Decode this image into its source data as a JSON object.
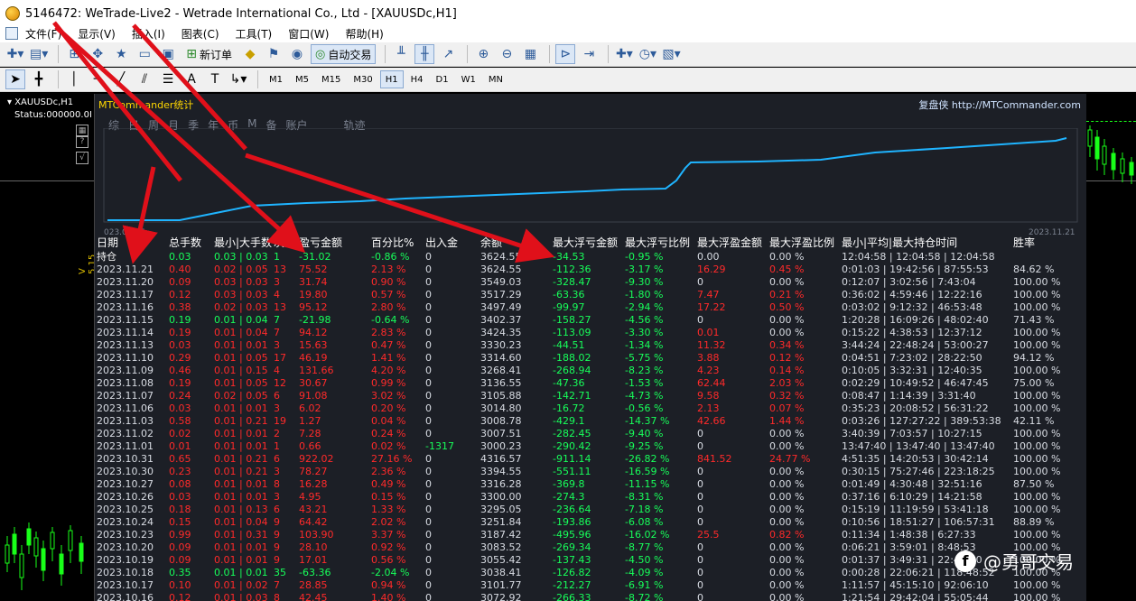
{
  "window": {
    "title": "5146472: WeTrade-Live2 - Wetrade International Co., Ltd - [XAUUSDc,H1]"
  },
  "menu": [
    "文件(F)",
    "显示(V)",
    "插入(I)",
    "图表(C)",
    "工具(T)",
    "窗口(W)",
    "帮助(H)"
  ],
  "toolbar1": {
    "new_order": "新订单",
    "auto_trade": "自动交易"
  },
  "timeframes": [
    "M1",
    "M5",
    "M15",
    "M30",
    "H1",
    "H4",
    "D1",
    "W1",
    "MN"
  ],
  "active_timeframe": "H1",
  "left_chart": {
    "symbol": "XAUUSDc,H1",
    "status": "Status:000000.0I",
    "side_label": "V 5.15"
  },
  "panel": {
    "title": "MTCommander统计",
    "brand": "复盘侠 http://MTCommander.com",
    "tabs": [
      "综",
      "日",
      "周",
      "月",
      "季",
      "年",
      "币",
      "M",
      "备",
      "账户"
    ],
    "track_label": "轨迹",
    "curve_start_label": "023.09.25",
    "curve_end_label": "2023.11.21"
  },
  "table": {
    "headers": [
      "日期",
      "总手数",
      "最小|大手数",
      "次数",
      "盈亏金额",
      "百分比%",
      "出入金",
      "余额",
      "最大浮亏金额",
      "最大浮亏比例",
      "最大浮盈金额",
      "最大浮盈比例",
      "最小|平均|最大持仓时间",
      "胜率"
    ],
    "holding_label": "持仓",
    "holding": [
      "0.03",
      "0.03 | 0.03",
      "1",
      "-31.02",
      "-0.86 %",
      "0",
      "3624.55",
      "-34.53",
      "-0.95 %",
      "0.00",
      "0.00 %",
      "12:04:58 | 12:04:58 | 12:04:58",
      ""
    ],
    "rows": [
      [
        "2023.11.21",
        "0.40",
        "0.02 | 0.05",
        "13",
        "75.52",
        "2.13 %",
        "0",
        "3624.55",
        "-112.36",
        "-3.17 %",
        "16.29",
        "0.45 %",
        "0:01:03 | 19:42:56 | 87:55:53",
        "84.62 %"
      ],
      [
        "2023.11.20",
        "0.09",
        "0.03 | 0.03",
        "3",
        "31.74",
        "0.90 %",
        "0",
        "3549.03",
        "-328.47",
        "-9.30 %",
        "0",
        "0.00 %",
        "0:12:07 | 3:02:56 | 7:43:04",
        "100.00 %"
      ],
      [
        "2023.11.17",
        "0.12",
        "0.03 | 0.03",
        "4",
        "19.80",
        "0.57 %",
        "0",
        "3517.29",
        "-63.36",
        "-1.80 %",
        "7.47",
        "0.21 %",
        "0:36:02 | 4:59:46 | 12:22:16",
        "100.00 %"
      ],
      [
        "2023.11.16",
        "0.38",
        "0.02 | 0.03",
        "13",
        "95.12",
        "2.80 %",
        "0",
        "3497.49",
        "-99.97",
        "-2.94 %",
        "17.22",
        "0.50 %",
        "0:03:02 | 9:12:32 | 46:53:48",
        "100.00 %"
      ],
      [
        "2023.11.15",
        "0.19",
        "0.01 | 0.04",
        "7",
        "-21.98",
        "-0.64 %",
        "0",
        "3402.37",
        "-158.27",
        "-4.56 %",
        "0",
        "0.00 %",
        "1:20:28 | 16:09:26 | 48:02:40",
        "71.43 %"
      ],
      [
        "2023.11.14",
        "0.19",
        "0.01 | 0.04",
        "7",
        "94.12",
        "2.83 %",
        "0",
        "3424.35",
        "-113.09",
        "-3.30 %",
        "0.01",
        "0.00 %",
        "0:15:22 | 4:38:53 | 12:37:12",
        "100.00 %"
      ],
      [
        "2023.11.13",
        "0.03",
        "0.01 | 0.01",
        "3",
        "15.63",
        "0.47 %",
        "0",
        "3330.23",
        "-44.51",
        "-1.34 %",
        "11.32",
        "0.34 %",
        "3:44:24 | 22:48:24 | 53:00:27",
        "100.00 %"
      ],
      [
        "2023.11.10",
        "0.29",
        "0.01 | 0.05",
        "17",
        "46.19",
        "1.41 %",
        "0",
        "3314.60",
        "-188.02",
        "-5.75 %",
        "3.88",
        "0.12 %",
        "0:04:51 | 7:23:02 | 28:22:50",
        "94.12 %"
      ],
      [
        "2023.11.09",
        "0.46",
        "0.01 | 0.15",
        "4",
        "131.66",
        "4.20 %",
        "0",
        "3268.41",
        "-268.94",
        "-8.23 %",
        "4.23",
        "0.14 %",
        "0:10:05 | 3:32:31 | 12:40:35",
        "100.00 %"
      ],
      [
        "2023.11.08",
        "0.19",
        "0.01 | 0.05",
        "12",
        "30.67",
        "0.99 %",
        "0",
        "3136.55",
        "-47.36",
        "-1.53 %",
        "62.44",
        "2.03 %",
        "0:02:29 | 10:49:52 | 46:47:45",
        "75.00 %"
      ],
      [
        "2023.11.07",
        "0.24",
        "0.02 | 0.05",
        "6",
        "91.08",
        "3.02 %",
        "0",
        "3105.88",
        "-142.71",
        "-4.73 %",
        "9.58",
        "0.32 %",
        "0:08:47 | 1:14:39 | 3:31:40",
        "100.00 %"
      ],
      [
        "2023.11.06",
        "0.03",
        "0.01 | 0.01",
        "3",
        "6.02",
        "0.20 %",
        "0",
        "3014.80",
        "-16.72",
        "-0.56 %",
        "2.13",
        "0.07 %",
        "0:35:23 | 20:08:52 | 56:31:22",
        "100.00 %"
      ],
      [
        "2023.11.03",
        "0.58",
        "0.01 | 0.21",
        "19",
        "1.27",
        "0.04 %",
        "0",
        "3008.78",
        "-429.1",
        "-14.37 %",
        "42.66",
        "1.44 %",
        "0:03:26 | 127:27:22 | 389:53:38",
        "42.11 %"
      ],
      [
        "2023.11.02",
        "0.02",
        "0.01 | 0.01",
        "2",
        "7.28",
        "0.24 %",
        "0",
        "3007.51",
        "-282.45",
        "-9.40 %",
        "0",
        "0.00 %",
        "3:40:39 | 7:03:57 | 10:27:15",
        "100.00 %"
      ],
      [
        "2023.11.01",
        "0.01",
        "0.01 | 0.01",
        "1",
        "0.66",
        "0.02 %",
        "-1317",
        "3000.23",
        "-290.42",
        "-9.25 %",
        "0",
        "0.00 %",
        "13:47:40 | 13:47:40 | 13:47:40",
        "100.00 %"
      ],
      [
        "2023.10.31",
        "0.65",
        "0.01 | 0.21",
        "6",
        "922.02",
        "27.16 %",
        "0",
        "4316.57",
        "-911.14",
        "-26.82 %",
        "841.52",
        "24.77 %",
        "4:51:35 | 14:20:53 | 30:42:14",
        "100.00 %"
      ],
      [
        "2023.10.30",
        "0.23",
        "0.01 | 0.21",
        "3",
        "78.27",
        "2.36 %",
        "0",
        "3394.55",
        "-551.11",
        "-16.59 %",
        "0",
        "0.00 %",
        "0:30:15 | 75:27:46 | 223:18:25",
        "100.00 %"
      ],
      [
        "2023.10.27",
        "0.08",
        "0.01 | 0.01",
        "8",
        "16.28",
        "0.49 %",
        "0",
        "3316.28",
        "-369.8",
        "-11.15 %",
        "0",
        "0.00 %",
        "0:01:49 | 4:30:48 | 32:51:16",
        "87.50 %"
      ],
      [
        "2023.10.26",
        "0.03",
        "0.01 | 0.01",
        "3",
        "4.95",
        "0.15 %",
        "0",
        "3300.00",
        "-274.3",
        "-8.31 %",
        "0",
        "0.00 %",
        "0:37:16 | 6:10:29 | 14:21:58",
        "100.00 %"
      ],
      [
        "2023.10.25",
        "0.18",
        "0.01 | 0.13",
        "6",
        "43.21",
        "1.33 %",
        "0",
        "3295.05",
        "-236.64",
        "-7.18 %",
        "0",
        "0.00 %",
        "0:15:19 | 11:19:59 | 53:41:18",
        "100.00 %"
      ],
      [
        "2023.10.24",
        "0.15",
        "0.01 | 0.04",
        "9",
        "64.42",
        "2.02 %",
        "0",
        "3251.84",
        "-193.86",
        "-6.08 %",
        "0",
        "0.00 %",
        "0:10:56 | 18:51:27 | 106:57:31",
        "88.89 %"
      ],
      [
        "2023.10.23",
        "0.99",
        "0.01 | 0.31",
        "9",
        "103.90",
        "3.37 %",
        "0",
        "3187.42",
        "-495.96",
        "-16.02 %",
        "25.5",
        "0.82 %",
        "0:11:34 | 1:48:38 | 6:27:33",
        "100.00 %"
      ],
      [
        "2023.10.20",
        "0.09",
        "0.01 | 0.01",
        "9",
        "28.10",
        "0.92 %",
        "0",
        "3083.52",
        "-269.34",
        "-8.77 %",
        "0",
        "0.00 %",
        "0:06:21 | 3:59:01 | 8:48:53",
        "100.00 %"
      ],
      [
        "2023.10.19",
        "0.09",
        "0.01 | 0.01",
        "9",
        "17.01",
        "0.56 %",
        "0",
        "3055.42",
        "-137.43",
        "-4.50 %",
        "0",
        "0.00 %",
        "0:01:37 | 3:49:31 | 22:43:50",
        "100.00 %"
      ],
      [
        "2023.10.18",
        "0.35",
        "0.01 | 0.01",
        "35",
        "-63.36",
        "-2.04 %",
        "0",
        "3038.41",
        "-126.82",
        "-4.09 %",
        "0",
        "0.00 %",
        "0:00:28 | 22:06:21 | 118:48:52",
        "100.00 %"
      ],
      [
        "2023.10.17",
        "0.10",
        "0.01 | 0.02",
        "7",
        "28.85",
        "0.94 %",
        "0",
        "3101.77",
        "-212.27",
        "-6.91 %",
        "0",
        "0.00 %",
        "1:11:57 | 45:15:10 | 92:06:10",
        "100.00 %"
      ],
      [
        "2023.10.16",
        "0.12",
        "0.01 | 0.03",
        "8",
        "42.45",
        "1.40 %",
        "0",
        "3072.92",
        "-266.33",
        "-8.72 %",
        "0",
        "0.00 %",
        "1:21:54 | 29:42:04 | 55:05:44",
        "100.00 %"
      ]
    ]
  },
  "colors": {
    "profit": "#ff2a2a",
    "loss": "#17ff5a",
    "curve": "#1fb4ff",
    "panel_bg": "#1c1f26",
    "arrow": "#e0101a"
  },
  "watermark": {
    "text": "@勇哥交易"
  }
}
